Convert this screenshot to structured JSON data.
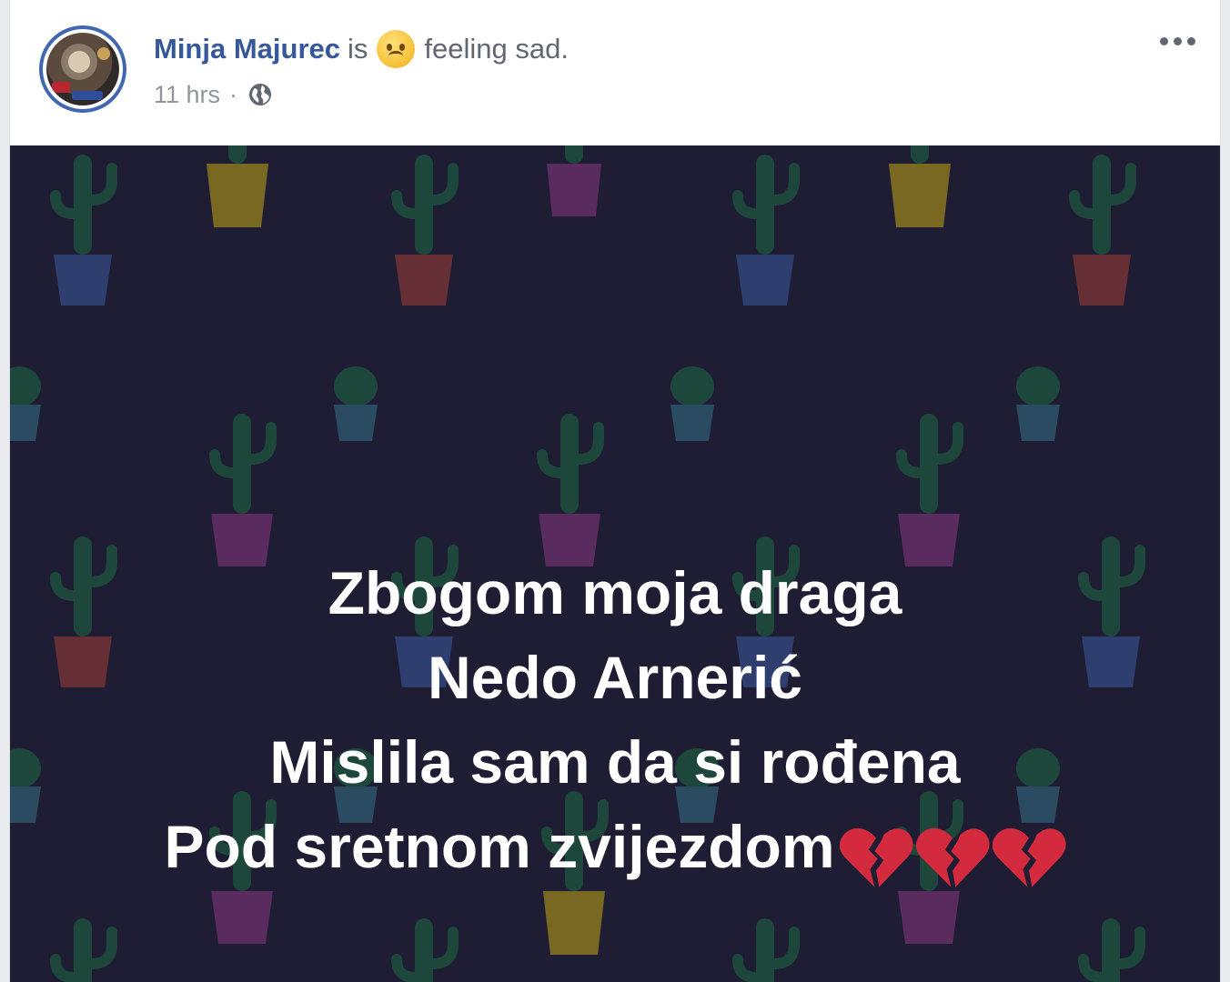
{
  "post": {
    "author": "Minja Majurec",
    "is_word": "is",
    "feeling_icon": "sad-face-emoji",
    "feeling_text": "feeling sad.",
    "timestamp": "11 hrs",
    "separator": "·",
    "privacy_icon": "globe-icon",
    "more_icon": "more-options-icon",
    "image_text": {
      "line1": "Zbogom moja draga",
      "line2": "Nedo Arnerić",
      "line3": "Mislila sam da si rođena",
      "line4": "Pod sretnom zvijezdom",
      "emoji": "broken-heart",
      "emoji_count": 3
    },
    "colors": {
      "author": "#365899",
      "background": "#1f1d33",
      "text": "#ffffff",
      "heart": "#d42a3d"
    }
  }
}
